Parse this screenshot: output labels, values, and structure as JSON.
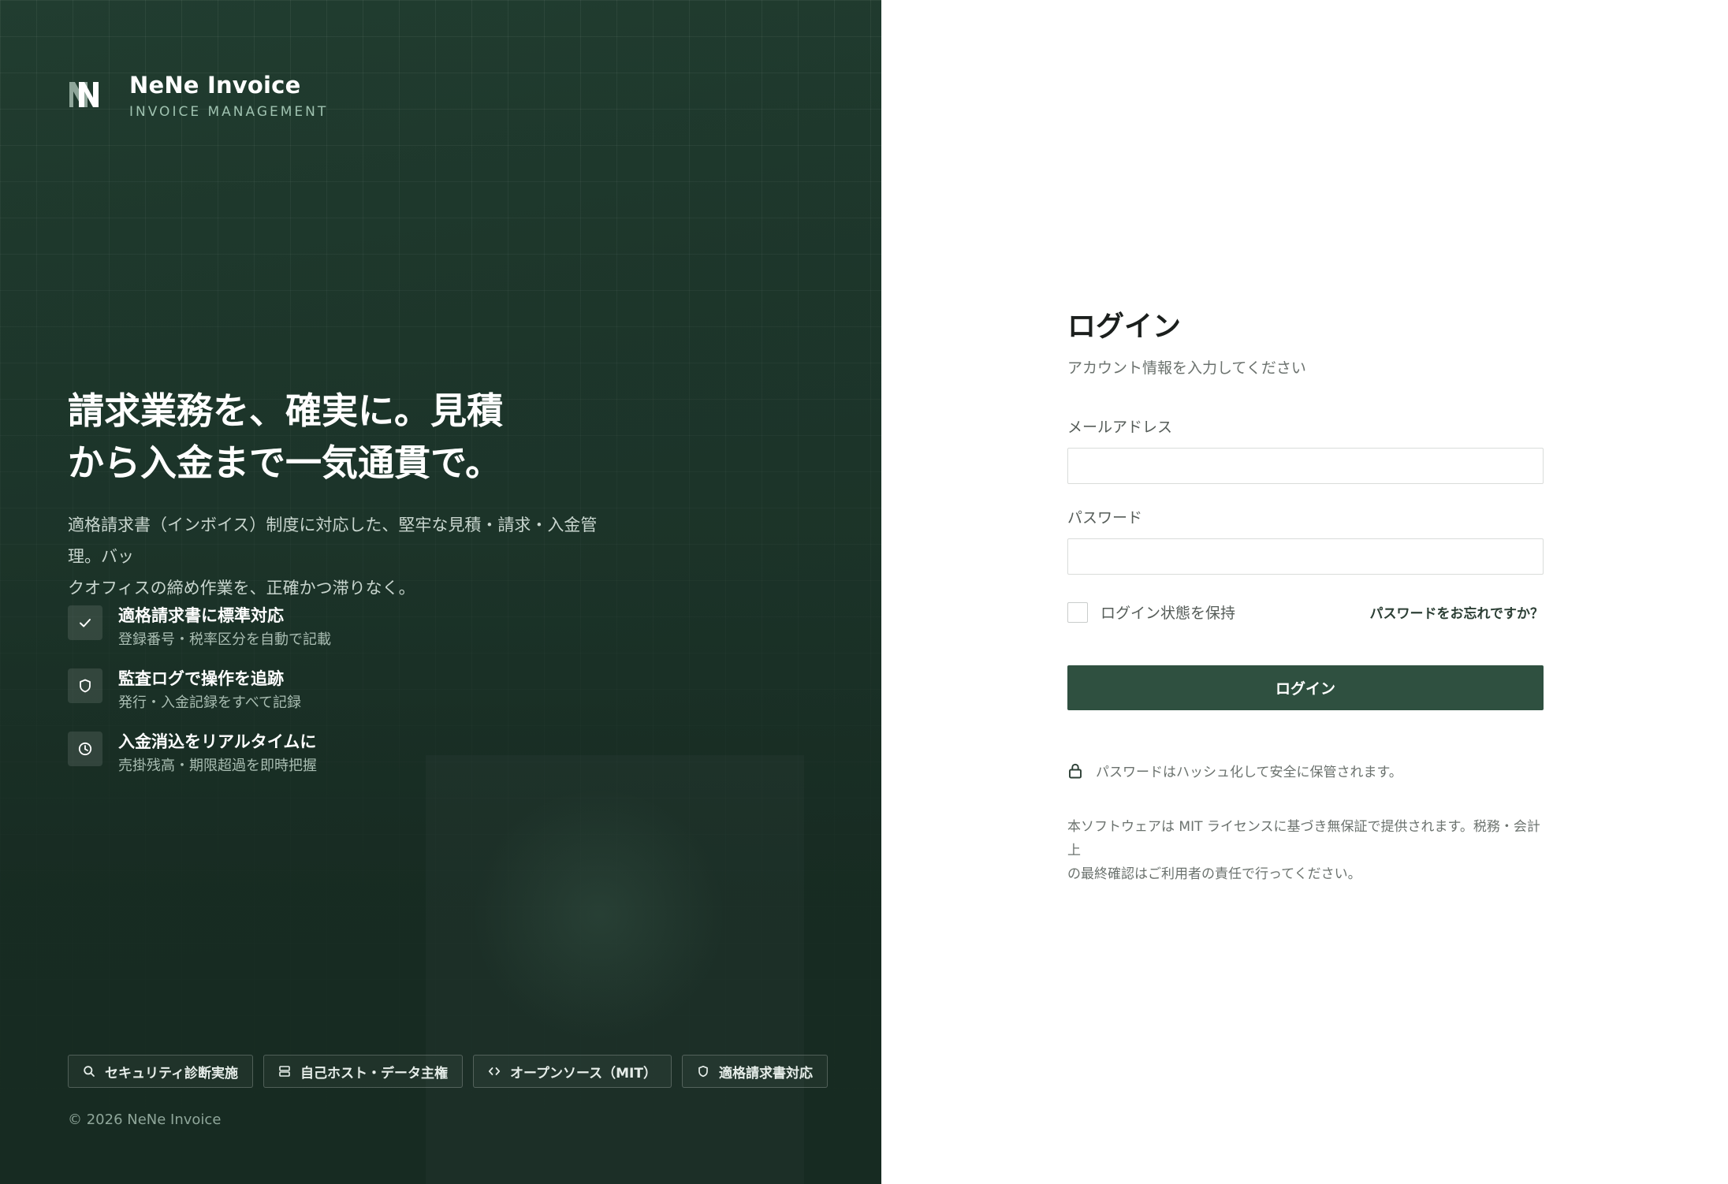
{
  "brand": {
    "name": "NeNe Invoice",
    "subtitle": "INVOICE MANAGEMENT",
    "logo_icon": "nene-logo-icon"
  },
  "hero": {
    "headline_line1": "請求業務を、確実に。見積",
    "headline_line2": "から入金まで一気通貫で。",
    "lead_line1": "適格請求書（インボイス）制度に対応した、堅牢な見積・請求・入金管理。バッ",
    "lead_line2": "クオフィスの締め作業を、正確かつ滞りなく。"
  },
  "features": [
    {
      "icon": "check-icon",
      "title": "適格請求書に標準対応",
      "desc": "登録番号・税率区分を自動で記載"
    },
    {
      "icon": "shield-icon",
      "title": "監査ログで操作を追跡",
      "desc": "発行・入金記録をすべて記録"
    },
    {
      "icon": "clock-icon",
      "title": "入金消込をリアルタイムに",
      "desc": "売掛残高・期限超過を即時把握"
    }
  ],
  "badges": [
    {
      "icon": "search-icon",
      "label": "セキュリティ診断実施"
    },
    {
      "icon": "server-icon",
      "label": "自己ホスト・データ主権"
    },
    {
      "icon": "code-icon",
      "label": "オープンソース（MIT）"
    },
    {
      "icon": "shield-icon",
      "label": "適格請求書対応"
    }
  ],
  "copyright": "© 2026 NeNe Invoice",
  "login": {
    "title": "ログイン",
    "subtitle": "アカウント情報を入力してください",
    "email_label": "メールアドレス",
    "email_value": "",
    "password_label": "パスワード",
    "password_value": "",
    "remember_label": "ログイン状態を保持",
    "forgot_link": "パスワードをお忘れですか？",
    "submit_label": "ログイン",
    "security_note": "パスワードはハッシュ化して安全に保管されます。",
    "legal_line1": "本ソフトウェアは MIT ライセンスに基づき無保証で提供されます。税務・会計上",
    "legal_line2": "の最終確認はご利用者の責任で行ってください。"
  },
  "colors": {
    "panel_bg": "#1c3429",
    "accent": "#2f5040",
    "text_dark": "#1b1f1d",
    "text_muted": "#6b726e"
  }
}
